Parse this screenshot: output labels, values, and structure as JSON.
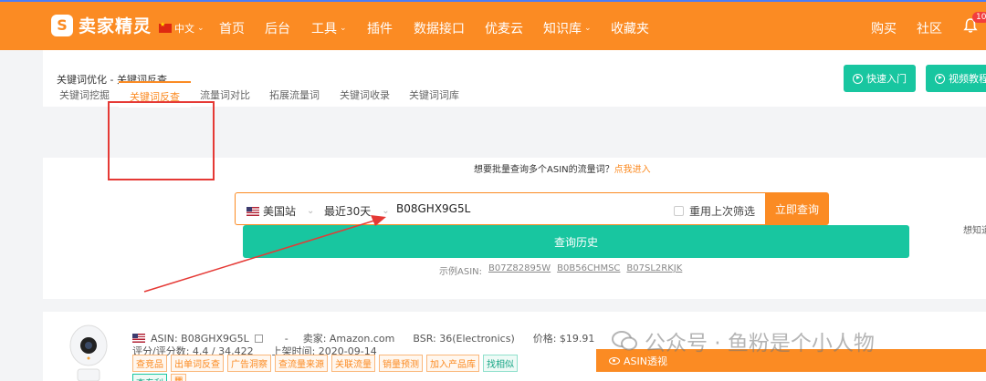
{
  "nav": {
    "logo_mark": "S",
    "logo_text": "卖家精灵",
    "lang": "中文",
    "items": [
      "首页",
      "后台",
      "工具",
      "插件",
      "数据接口",
      "优麦云",
      "知识库",
      "收藏夹"
    ],
    "right": [
      "购买",
      "社区"
    ],
    "badge": "10"
  },
  "breadcrumb": "关键词优化 - 关键词反查",
  "quick_start": "快速入门",
  "video_tutorial": "视频教程",
  "tabs": [
    "关键词挖掘",
    "关键词反查",
    "流量词对比",
    "拓展流量词",
    "关键词收录",
    "关键词词库"
  ],
  "hint": {
    "text": "想要批量查询多个ASIN的流量词？",
    "link": "点我进入"
  },
  "search": {
    "marketplace": "美国站",
    "range": "最近30天",
    "asin": "B08GHX9G5L",
    "reuse_label": "重用上次筛选",
    "query_button": "立即查询",
    "history_button": "查询历史"
  },
  "sample": {
    "label": "示例ASIN:",
    "codes": [
      "B07Z82895W",
      "B0B56CHMSC",
      "B07SL2RKJK"
    ]
  },
  "side_hint": "想知道",
  "product": {
    "asin_line": "ASIN: B08GHX9G5L",
    "seller": "-",
    "seller_label": "卖家: Amazon.com",
    "bsr": "BSR: 36(Electronics)",
    "price": "价格: $19.91",
    "rating": "评分/评分数: 4.4 / 34,422",
    "listed": "上架时间: 2020-09-14",
    "tags": [
      "查竞品",
      "出单词反查",
      "广告洞察",
      "查流量来源",
      "关联流量",
      "销量预测",
      "加入产品库"
    ],
    "tag_green": "找相似",
    "tags2": [
      "查专利"
    ],
    "asin_view": "ASIN透视"
  },
  "watermark": "公众号 · 鱼粉是个小人物",
  "colors": {
    "brand": "#fb8b23",
    "green": "#18c6a0",
    "highlight": "#e53935"
  }
}
